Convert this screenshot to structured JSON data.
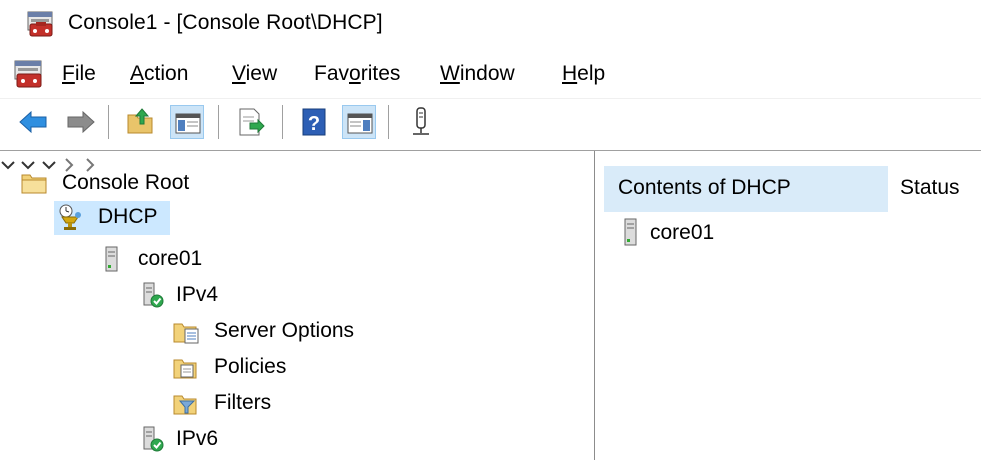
{
  "window": {
    "title": "Console1 - [Console Root\\DHCP]"
  },
  "menu": {
    "items": [
      {
        "key": "F",
        "rest": "ile"
      },
      {
        "key": "A",
        "rest": "ction"
      },
      {
        "key": "V",
        "rest": "iew"
      },
      {
        "pre": "Fav",
        "key": "o",
        "rest": "rites"
      },
      {
        "key": "W",
        "rest": "indow"
      },
      {
        "key": "H",
        "rest": "elp"
      }
    ]
  },
  "toolbar": {
    "buttons": [
      "back-arrow-icon",
      "forward-arrow-icon",
      "up-folder-icon",
      "show-hide-tree-icon",
      "export-list-icon",
      "help-icon",
      "show-hide-action-pane-icon",
      "connect-icon"
    ]
  },
  "tree": {
    "items": [
      {
        "label": "Console Root",
        "icon": "folder-icon"
      },
      {
        "label": "DHCP",
        "icon": "dhcp-icon",
        "selected": true,
        "expanded": true
      },
      {
        "label": "core01",
        "icon": "server-icon",
        "expanded": true
      },
      {
        "label": "IPv4",
        "icon": "ipv4-icon",
        "expanded": true
      },
      {
        "label": "Server Options",
        "icon": "server-options-folder-icon"
      },
      {
        "label": "Policies",
        "icon": "policies-folder-icon"
      },
      {
        "label": "Filters",
        "icon": "filters-folder-icon",
        "expanded": false
      },
      {
        "label": "IPv6",
        "icon": "ipv6-icon",
        "expanded": false
      }
    ]
  },
  "list": {
    "columns": [
      "Contents of DHCP",
      "Status"
    ],
    "rows": [
      {
        "name": "core01",
        "icon": "server-icon"
      }
    ]
  },
  "colors": {
    "selection": "#cce8ff",
    "column_highlight": "#d9ebf9",
    "toolbar_active": "#cce4f7"
  }
}
